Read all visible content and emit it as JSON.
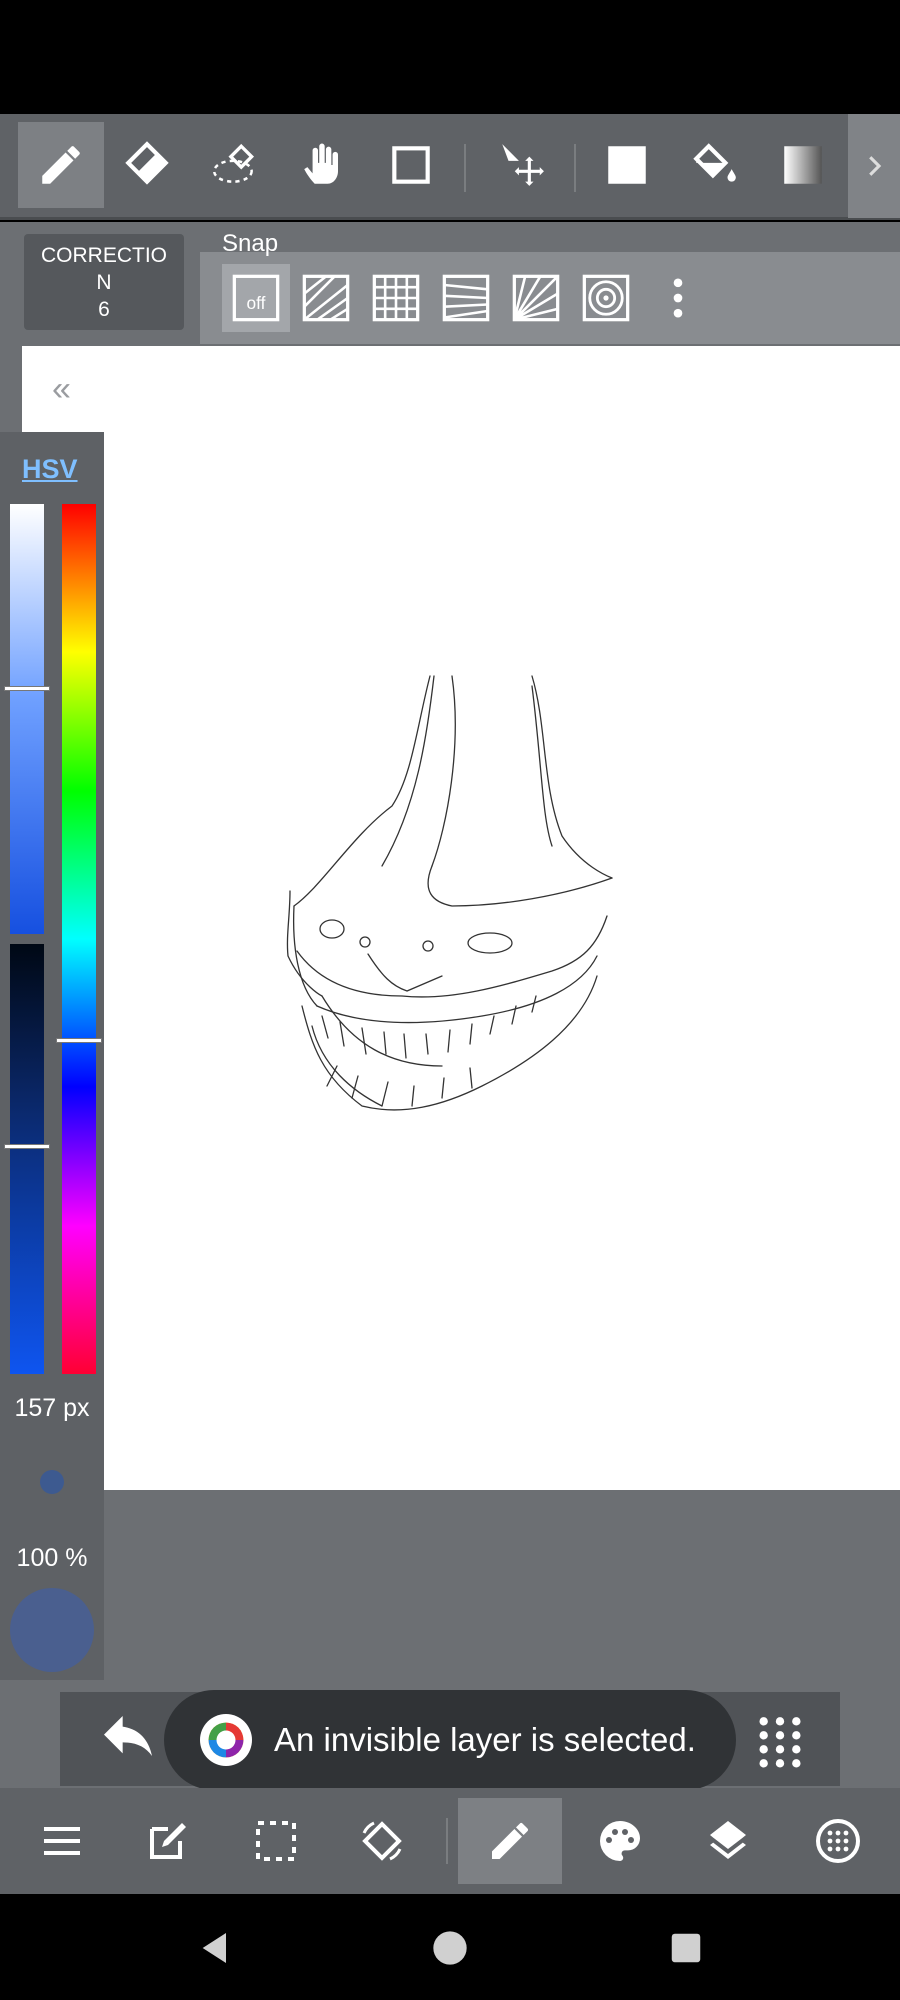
{
  "toolbar": {
    "tools": [
      {
        "name": "pen-tool",
        "active": true
      },
      {
        "name": "eraser-tool"
      },
      {
        "name": "lasso-eraser-tool"
      },
      {
        "name": "hand-tool"
      },
      {
        "name": "rectangle-tool"
      },
      {
        "name": "move-tool"
      },
      {
        "name": "fill-color-tool"
      },
      {
        "name": "bucket-tool"
      },
      {
        "name": "gradient-tool"
      }
    ]
  },
  "subbar": {
    "correction_line1": "CORRECTIO",
    "correction_line2": "N",
    "correction_value": "6",
    "snap_label": "Snap",
    "snap_off_label": "off"
  },
  "colorpanel": {
    "mode_label": "HSV",
    "brush_size": "157 px",
    "opacity": "100 %",
    "current_color": "#4a5f8f"
  },
  "toast": {
    "message": "An invisible layer is selected."
  },
  "bottommenu": {
    "items": [
      "menu",
      "edit",
      "selection",
      "rotate",
      "brush",
      "palette",
      "layers",
      "settings"
    ],
    "active": "brush"
  },
  "colors": {
    "toolbar_bg": "#5f6266",
    "accent_link": "#7fbfff",
    "canvas_bg": "#ffffff"
  }
}
